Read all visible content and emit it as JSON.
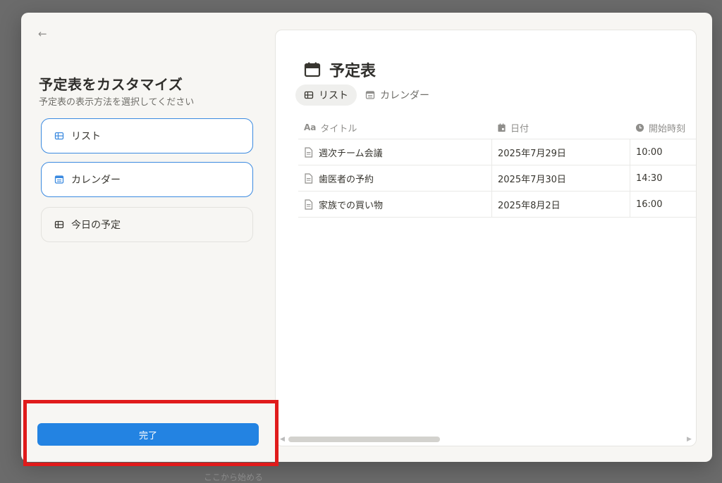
{
  "left": {
    "back_icon": "←",
    "title": "予定表をカスタマイズ",
    "subtitle": "予定表の表示方法を選択してください",
    "options": [
      {
        "label": "リスト",
        "icon": "table-icon",
        "selected": true
      },
      {
        "label": "カレンダー",
        "icon": "calendar-icon",
        "selected": true
      },
      {
        "label": "今日の予定",
        "icon": "table-icon",
        "selected": false
      }
    ],
    "done_label": "完了"
  },
  "preview": {
    "title": "予定表",
    "tabs": [
      {
        "label": "リスト",
        "active": true
      },
      {
        "label": "カレンダー",
        "active": false
      }
    ],
    "columns": [
      {
        "label": "タイトル",
        "icon": "text-aa-icon",
        "icon_text": "Aa"
      },
      {
        "label": "日付",
        "icon": "calendar-icon"
      },
      {
        "label": "開始時刻",
        "icon": "clock-icon"
      }
    ],
    "rows": [
      {
        "title": "週次チーム会議",
        "date": "2025年7月29日",
        "time": "10:00"
      },
      {
        "title": "歯医者の予約",
        "date": "2025年7月30日",
        "time": "14:30"
      },
      {
        "title": "家族での買い物",
        "date": "2025年8月2日",
        "time": "16:00"
      }
    ]
  },
  "footer_hint": "ここから始める",
  "colors": {
    "accent": "#2383e2",
    "highlight": "#e01b1b",
    "selected_border": "#3b8ae0"
  }
}
